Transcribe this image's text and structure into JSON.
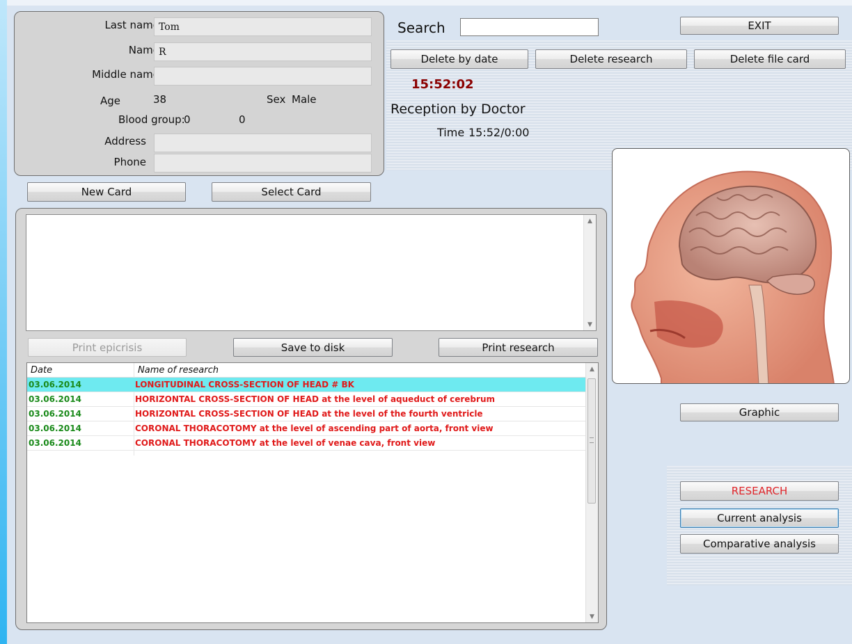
{
  "patient": {
    "last_name_label": "Last name",
    "last_name_value": "Tom",
    "name_label": "Name",
    "name_value": "R",
    "middle_name_label": "Middle name",
    "middle_name_value": "",
    "age_label": "Age",
    "age_value": "38",
    "sex_label": "Sex",
    "sex_value": "Male",
    "blood_group_label": "Blood group:",
    "blood_group_value1": "0",
    "blood_group_value2": "0",
    "address_label": "Address",
    "address_value": "",
    "phone_label": "Phone",
    "phone_value": ""
  },
  "card_buttons": {
    "new_card": "New Card",
    "select_card": "Select Card"
  },
  "search": {
    "label": "Search",
    "value": ""
  },
  "top_buttons": {
    "exit": "EXIT",
    "delete_by_date": "Delete by date",
    "delete_research": "Delete research",
    "delete_file_card": "Delete file card"
  },
  "status": {
    "clock": "15:52:02",
    "reception": "Reception by Doctor",
    "time_label": "Time",
    "time_value": "15:52/0:00"
  },
  "actions": {
    "print_epicrisis": "Print epicrisis",
    "save_to_disk": "Save to disk",
    "print_research": "Print research"
  },
  "research_table": {
    "col_date": "Date",
    "col_name": "Name of research",
    "rows": [
      {
        "date": "03.06.2014",
        "name": "LONGITUDINAL CROSS-SECTION OF HEAD # BK"
      },
      {
        "date": "03.06.2014",
        "name": "HORIZONTAL CROSS-SECTION OF HEAD at the level of aqueduct of cerebrum"
      },
      {
        "date": "03.06.2014",
        "name": "HORIZONTAL CROSS-SECTION OF HEAD at the level of the fourth ventricle"
      },
      {
        "date": "03.06.2014",
        "name": "CORONAL THORACOTOMY at the level of ascending part of aorta, front view"
      },
      {
        "date": "03.06.2014",
        "name": "CORONAL THORACOTOMY at the level of venae cava, front view"
      }
    ]
  },
  "right_buttons": {
    "graphic": "Graphic",
    "research": "RESEARCH",
    "current_analysis": "Current analysis",
    "comparative_analysis": "Comparative analysis"
  },
  "colors": {
    "date_green": "#1a8a1a",
    "research_red": "#e01a1a",
    "clock_darkred": "#8b0000",
    "selected_row": "#6eeaf0"
  }
}
